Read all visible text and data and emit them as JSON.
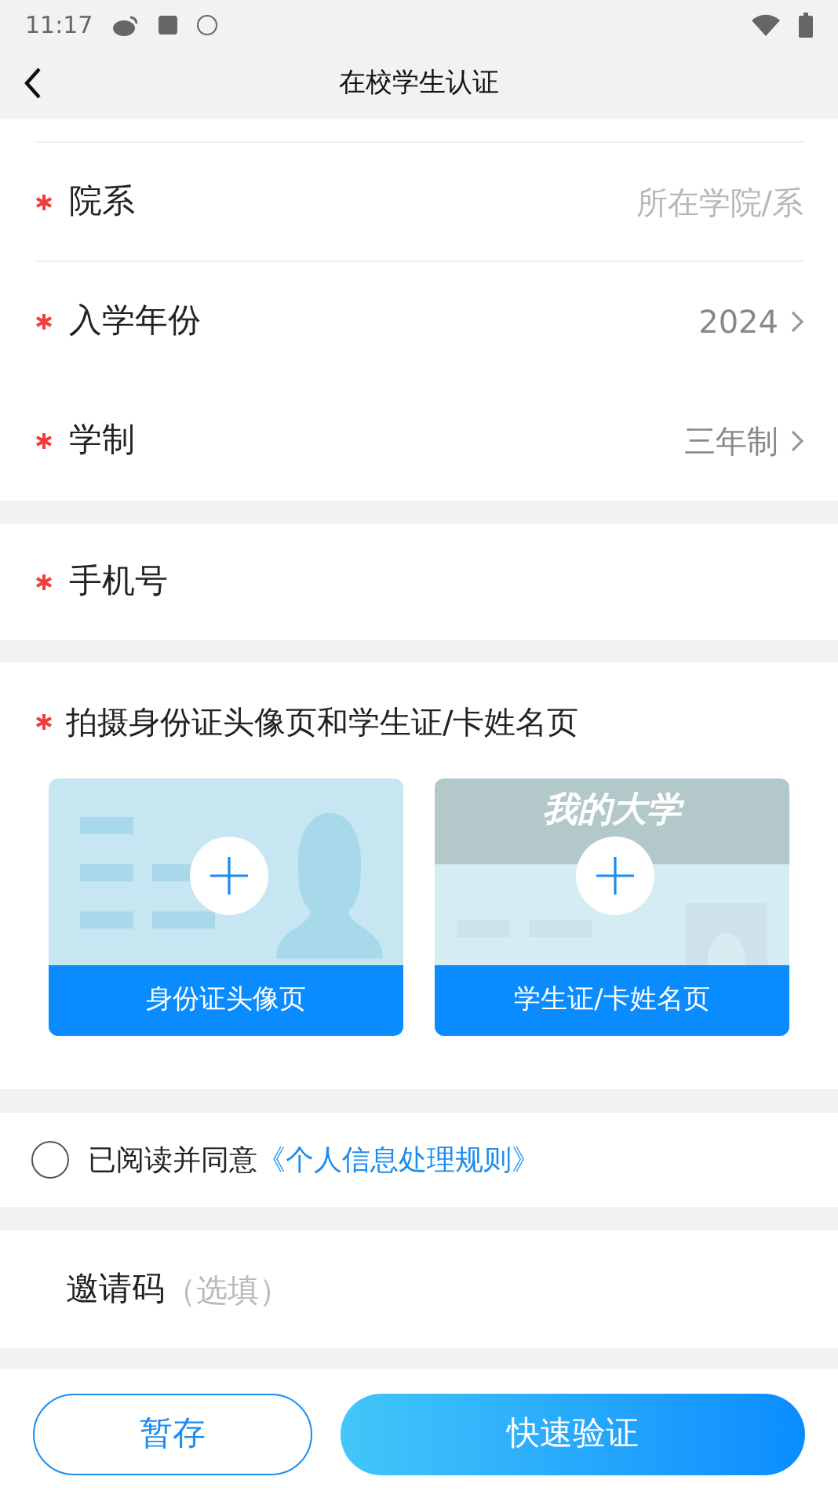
{
  "status_bar": {
    "time": "11:17"
  },
  "header": {
    "title": "在校学生认证"
  },
  "profile_fields": [
    {
      "kind": "input",
      "required": true,
      "label": "院系",
      "placeholder": "所在学院/系"
    },
    {
      "kind": "select",
      "required": true,
      "label": "入学年份",
      "value": "2024"
    },
    {
      "kind": "select",
      "required": true,
      "label": "学制",
      "value": "三年制"
    }
  ],
  "phone_field": {
    "required": true,
    "label": "手机号"
  },
  "photo_section": {
    "required": true,
    "title": "拍摄身份证头像页和学生证/卡姓名页",
    "cards": [
      {
        "kind": "id_card",
        "label": "身份证头像页"
      },
      {
        "kind": "student_card",
        "banner": "我的大学",
        "label": "学生证/卡姓名页"
      }
    ]
  },
  "agreement": {
    "checked": false,
    "text": "已阅读并同意",
    "link": "《个人信息处理规则》"
  },
  "invite_field": {
    "label": "邀请码",
    "placeholder": "（选填）"
  },
  "buttons": [
    {
      "kind": "outline",
      "label": "暂存"
    },
    {
      "kind": "primary",
      "label": "快速验证"
    }
  ]
}
